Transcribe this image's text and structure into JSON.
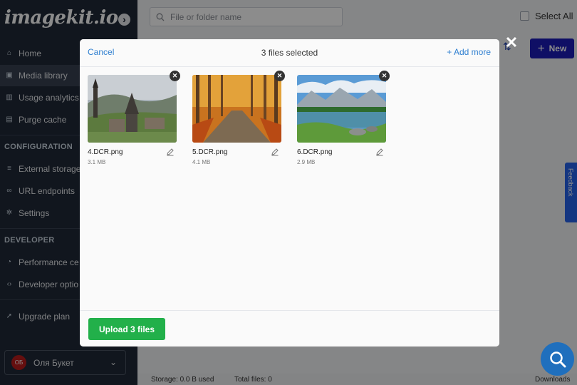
{
  "brand": {
    "name": "imagekit.io"
  },
  "sidebar": {
    "collapse_icon": "arrow-circle-icon",
    "main_items": [
      {
        "label": "Home",
        "icon": "home-icon"
      },
      {
        "label": "Media library",
        "icon": "media-icon",
        "active": true
      },
      {
        "label": "Usage analytics",
        "icon": "chart-icon"
      },
      {
        "label": "Purge cache",
        "icon": "purge-icon"
      }
    ],
    "configuration": {
      "heading": "CONFIGURATION",
      "items": [
        {
          "label": "External storage",
          "icon": "database-icon"
        },
        {
          "label": "URL endpoints",
          "icon": "link-icon"
        },
        {
          "label": "Settings",
          "icon": "gear-icon"
        }
      ]
    },
    "developer": {
      "heading": "DEVELOPER",
      "items": [
        {
          "label": "Performance ce",
          "icon": "gauge-icon"
        },
        {
          "label": "Developer optio",
          "icon": "code-icon"
        }
      ]
    },
    "upgrade": {
      "label": "Upgrade plan",
      "icon": "rocket-icon"
    },
    "user": {
      "initials": "ОБ",
      "name": "Оля Букет"
    }
  },
  "topbar": {
    "search_placeholder": "File or folder name",
    "select_all_label": "Select All",
    "new_button_label": "New",
    "feedback_label": "Feedback"
  },
  "status_bar": {
    "storage": "Storage: 0.0 B used",
    "total_files": "Total files: 0",
    "downloads": "Downloads"
  },
  "modal": {
    "cancel_label": "Cancel",
    "title": "3 files selected",
    "add_more_label": "+ Add more",
    "upload_label": "Upload 3 files",
    "files": [
      {
        "name": "4.DCR.png",
        "size": "3.1 MB",
        "subject": "village-church-photo"
      },
      {
        "name": "5.DCR.png",
        "size": "4.1 MB",
        "subject": "autumn-forest-path-photo"
      },
      {
        "name": "6.DCR.png",
        "size": "2.9 MB",
        "subject": "mountain-lake-photo"
      }
    ]
  },
  "colors": {
    "sidebar_bg": "#1f2937",
    "accent_blue": "#2f7fd0",
    "new_button": "#1d1db8",
    "upload_green": "#22b04a"
  }
}
